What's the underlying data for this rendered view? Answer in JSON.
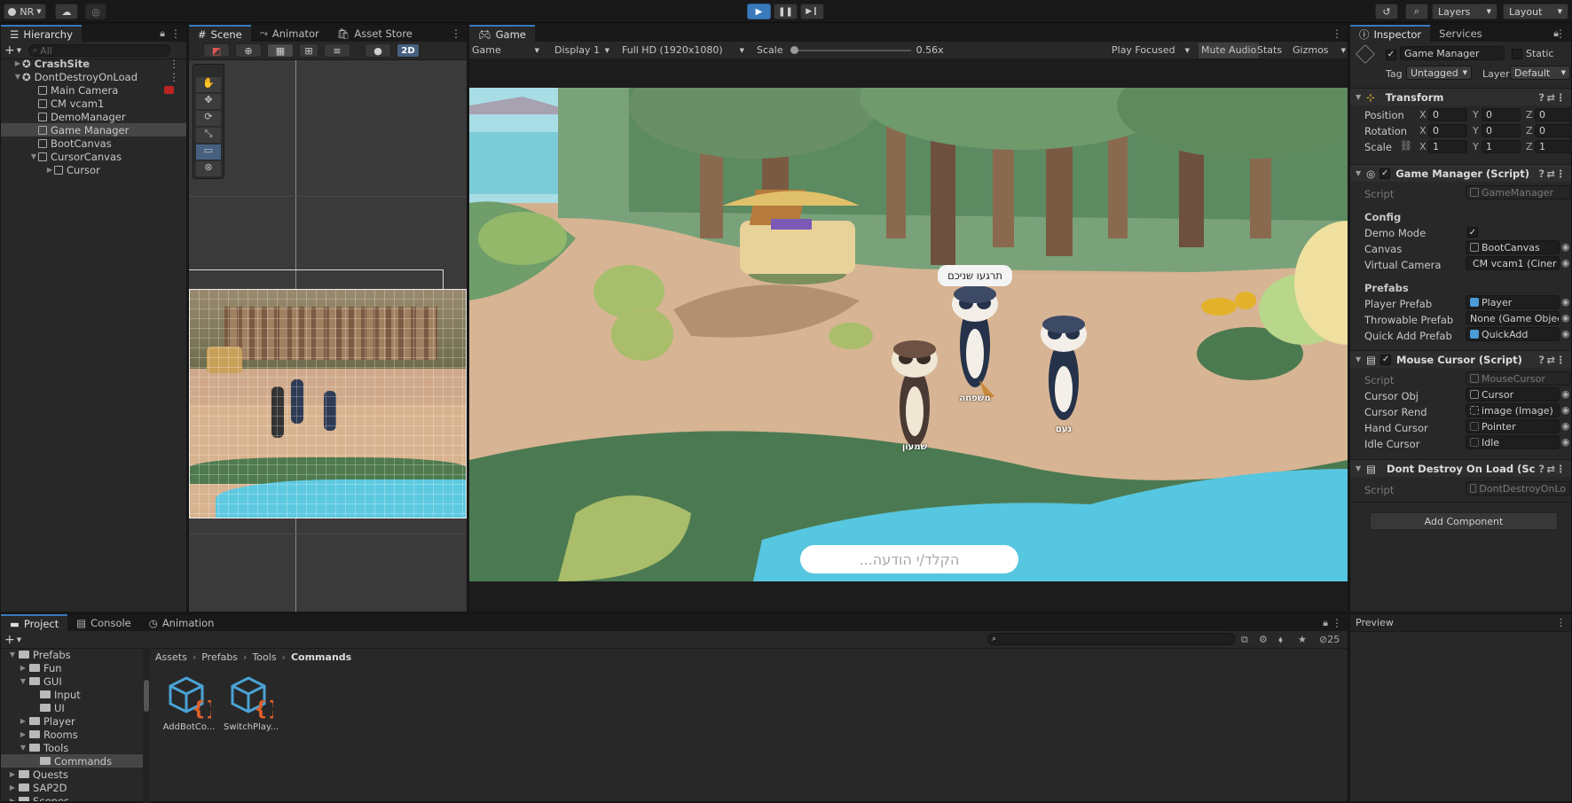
{
  "toolbar": {
    "account": "NR",
    "layers": "Layers",
    "layout": "Layout"
  },
  "hierarchy": {
    "tab": "Hierarchy",
    "search_placeholder": "All",
    "items": [
      {
        "label": "CrashSite",
        "indent": 0,
        "bold": true
      },
      {
        "label": "DontDestroyOnLoad",
        "indent": 0,
        "bold": false
      },
      {
        "label": "Main Camera",
        "indent": 1
      },
      {
        "label": "CM vcam1",
        "indent": 1
      },
      {
        "label": "DemoManager",
        "indent": 1
      },
      {
        "label": "Game Manager",
        "indent": 1,
        "selected": true
      },
      {
        "label": "BootCanvas",
        "indent": 1
      },
      {
        "label": "CursorCanvas",
        "indent": 1
      },
      {
        "label": "Cursor",
        "indent": 2
      }
    ]
  },
  "scene": {
    "tabs": [
      "Scene",
      "Animator",
      "Asset Store"
    ],
    "mode_2d": "2D"
  },
  "game": {
    "tab": "Game",
    "view_select": "Game",
    "display": "Display 1",
    "resolution": "Full HD (1920x1080)",
    "scale_label": "Scale",
    "scale_value": "0.56x",
    "play_focused": "Play Focused",
    "mute_audio": "Mute Audio",
    "stats": "Stats",
    "gizmos": "Gizmos",
    "speech_bubble": "תרגעו שניכם",
    "char_names": [
      "שמעון",
      "נעם",
      "משפחה"
    ],
    "chat_placeholder": "הקלד/י הודעה..."
  },
  "inspector": {
    "tabs": [
      "Inspector",
      "Services"
    ],
    "object_name": "Game Manager",
    "static_label": "Static",
    "tag_label": "Tag",
    "tag_value": "Untagged",
    "layer_label": "Layer",
    "layer_value": "Default",
    "transform": {
      "title": "Transform",
      "rows": [
        {
          "label": "Position",
          "x": "0",
          "y": "0",
          "z": "0"
        },
        {
          "label": "Rotation",
          "x": "0",
          "y": "0",
          "z": "0"
        },
        {
          "label": "Scale",
          "x": "1",
          "y": "1",
          "z": "1"
        }
      ]
    },
    "game_manager": {
      "title": "Game Manager (Script)",
      "script_label": "Script",
      "script_value": "GameManager",
      "config_header": "Config",
      "demo_mode": "Demo Mode",
      "canvas_label": "Canvas",
      "canvas_value": "BootCanvas",
      "vcam_label": "Virtual Camera",
      "vcam_value": "CM vcam1 (Ciner",
      "prefabs_header": "Prefabs",
      "player_prefab_label": "Player Prefab",
      "player_prefab_value": "Player",
      "throwable_label": "Throwable Prefab",
      "throwable_value": "None (Game Object",
      "quickadd_label": "Quick Add Prefab",
      "quickadd_value": "QuickAdd"
    },
    "mouse_cursor": {
      "title": "Mouse Cursor (Script)",
      "script_label": "Script",
      "script_value": "MouseCursor",
      "cursor_obj_label": "Cursor Obj",
      "cursor_obj_value": "Cursor",
      "cursor_rend_label": "Cursor Rend",
      "cursor_rend_value": "image (Image)",
      "hand_label": "Hand Cursor",
      "hand_value": "Pointer",
      "idle_label": "Idle Cursor",
      "idle_value": "Idle"
    },
    "dont_destroy": {
      "title": "Dont Destroy On Load (Sc",
      "script_label": "Script",
      "script_value": "DontDestroyOnLo"
    },
    "add_component": "Add Component",
    "preview": "Preview"
  },
  "project": {
    "tabs": [
      "Project",
      "Console",
      "Animation"
    ],
    "count": "25",
    "breadcrumb": [
      "Assets",
      "Prefabs",
      "Tools",
      "Commands"
    ],
    "tree": [
      {
        "label": "Prefabs",
        "indent": 0
      },
      {
        "label": "Fun",
        "indent": 1
      },
      {
        "label": "GUI",
        "indent": 1
      },
      {
        "label": "Input",
        "indent": 2
      },
      {
        "label": "UI",
        "indent": 2
      },
      {
        "label": "Player",
        "indent": 1
      },
      {
        "label": "Rooms",
        "indent": 1
      },
      {
        "label": "Tools",
        "indent": 1
      },
      {
        "label": "Commands",
        "indent": 2,
        "selected": true
      },
      {
        "label": "Quests",
        "indent": 0
      },
      {
        "label": "SAP2D",
        "indent": 0
      },
      {
        "label": "Scenes",
        "indent": 0
      }
    ],
    "assets": [
      "AddBotCo...",
      "SwitchPlay..."
    ]
  }
}
